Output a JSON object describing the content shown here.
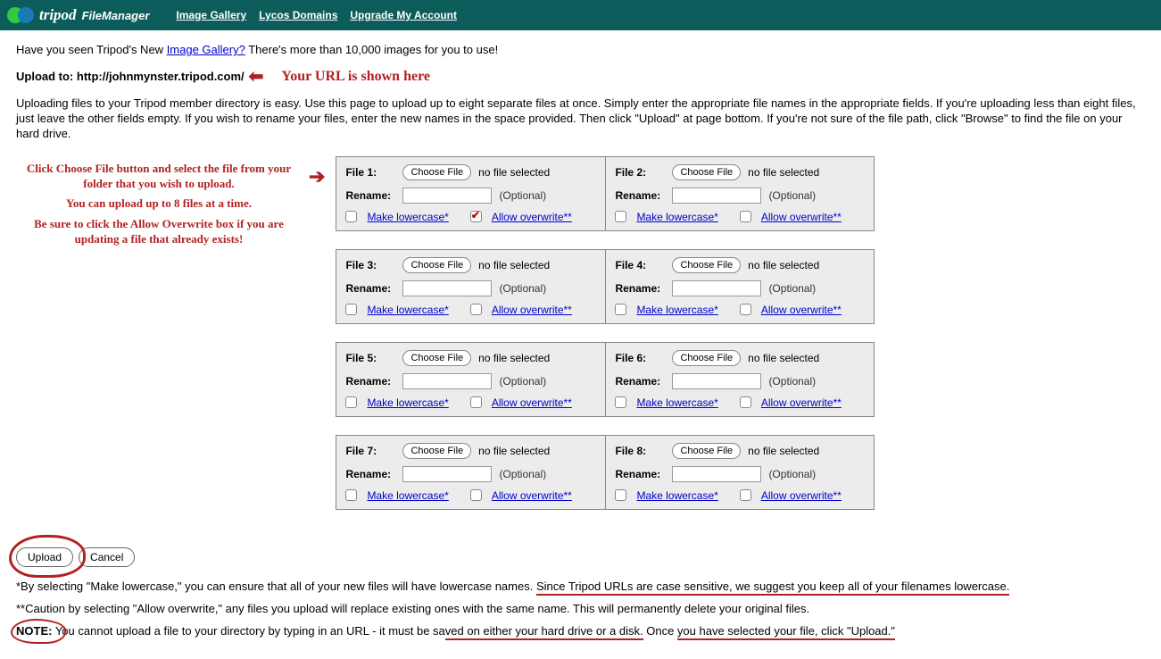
{
  "header": {
    "brand_a": "tripod",
    "brand_b": "FileManager",
    "nav": [
      "Image Gallery",
      "Lycos Domains",
      "Upgrade My Account"
    ]
  },
  "intro": {
    "pre": "Have you seen Tripod's New ",
    "link": "Image Gallery?",
    "post": " There's more than 10,000 images for you to use!"
  },
  "url": {
    "label": "Upload to: http://johnmynster.tripod.com/",
    "annot": "Your URL is shown here"
  },
  "desc": "Uploading files to your Tripod member directory is easy. Use this page to upload up to eight separate files at once. Simply enter the appropriate file names in the appropriate fields. If you're uploading less than eight files, just leave the other fields empty. If you wish to rename your files, enter the new names in the space provided. Then click \"Upload\" at page bottom. If you're not sure of the file path, click \"Browse\" to find the file on your hard drive.",
  "left": [
    "Click Choose File button and select the file from your folder that you wish to upload.",
    "You can upload up to 8 files at a time.",
    "Be sure to click the Allow Overwrite box if you are updating a file that already exists!"
  ],
  "common": {
    "choose": "Choose File",
    "nofile": "no file selected",
    "rename": "Rename:",
    "optional": "(Optional)",
    "lowercase": "Make lowercase*",
    "overwrite": "Allow overwrite**"
  },
  "files": [
    {
      "label": "File 1:",
      "allow": true
    },
    {
      "label": "File 2:",
      "allow": false
    },
    {
      "label": "File 3:",
      "allow": false
    },
    {
      "label": "File 4:",
      "allow": false
    },
    {
      "label": "File 5:",
      "allow": false
    },
    {
      "label": "File 6:",
      "allow": false
    },
    {
      "label": "File 7:",
      "allow": false
    },
    {
      "label": "File 8:",
      "allow": false
    }
  ],
  "actions": {
    "upload": "Upload",
    "cancel": "Cancel"
  },
  "foot1": {
    "pre": "*By selecting \"Make lowercase,\" you can ensure that all of your new files will have lowercase names. ",
    "ul": "Since Tripod URLs are case sensitive, we suggest you keep all of your filenames lowercase."
  },
  "foot2": "**Caution by selecting \"Allow overwrite,\" any files you upload will replace existing ones with the same name. This will permanently delete your original files.",
  "foot3": {
    "note": "NOTE:",
    "mid": " You cannot upload a file to your directory by typing in an URL - it must be sa",
    "ul1": "ved on either your hard drive or a disk.",
    "mid2": " Once ",
    "ul2": "you have selected your file, click \"Upload.\""
  }
}
